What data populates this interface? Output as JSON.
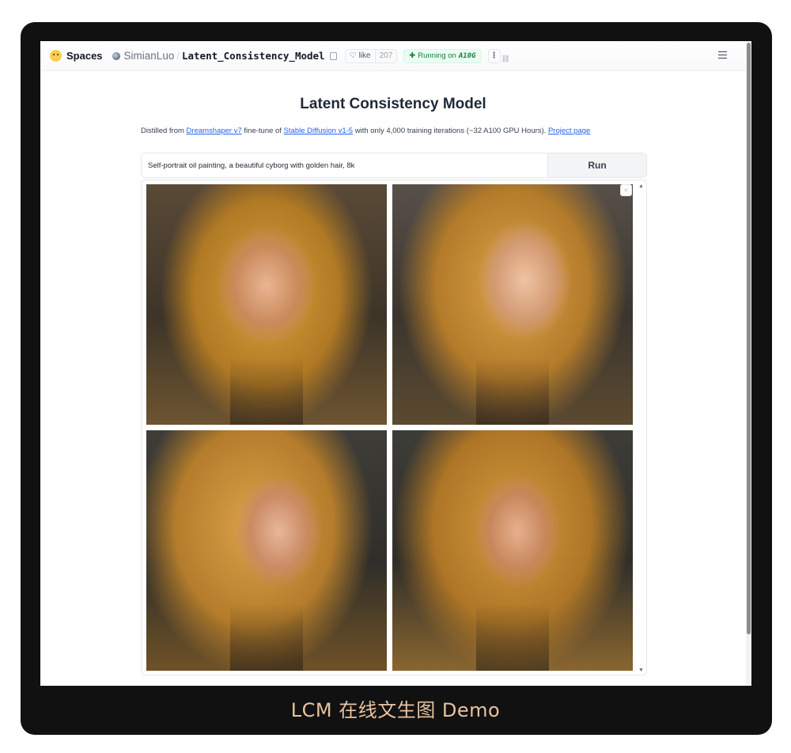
{
  "topbar": {
    "spaces_label": "Spaces",
    "username": "SimianLuo",
    "separator": "/",
    "repo_name": "Latent_Consistency_Model",
    "like_label": "like",
    "like_count": "207",
    "running_label": "Running on",
    "hardware": "A10G",
    "more_label": "⋮"
  },
  "main": {
    "title": "Latent Consistency Model",
    "description": {
      "prefix": "Distilled from ",
      "link1": "Dreamshaper v7",
      "mid1": " fine-tune of ",
      "link2": "Stable Diffusion v1-5",
      "mid2": " with only 4,000 training iterations (~32 A100 GPU Hours). ",
      "link3": "Project page"
    },
    "prompt_value": "Self-portrait oil painting, a beautiful cyborg with golden hair, 8k",
    "run_label": "Run"
  },
  "caption": "LCM 在线文生图 Demo",
  "colors": {
    "frame": "#111111",
    "caption": "#e8c39e",
    "link": "#2563eb",
    "running_green": "#15803d"
  }
}
